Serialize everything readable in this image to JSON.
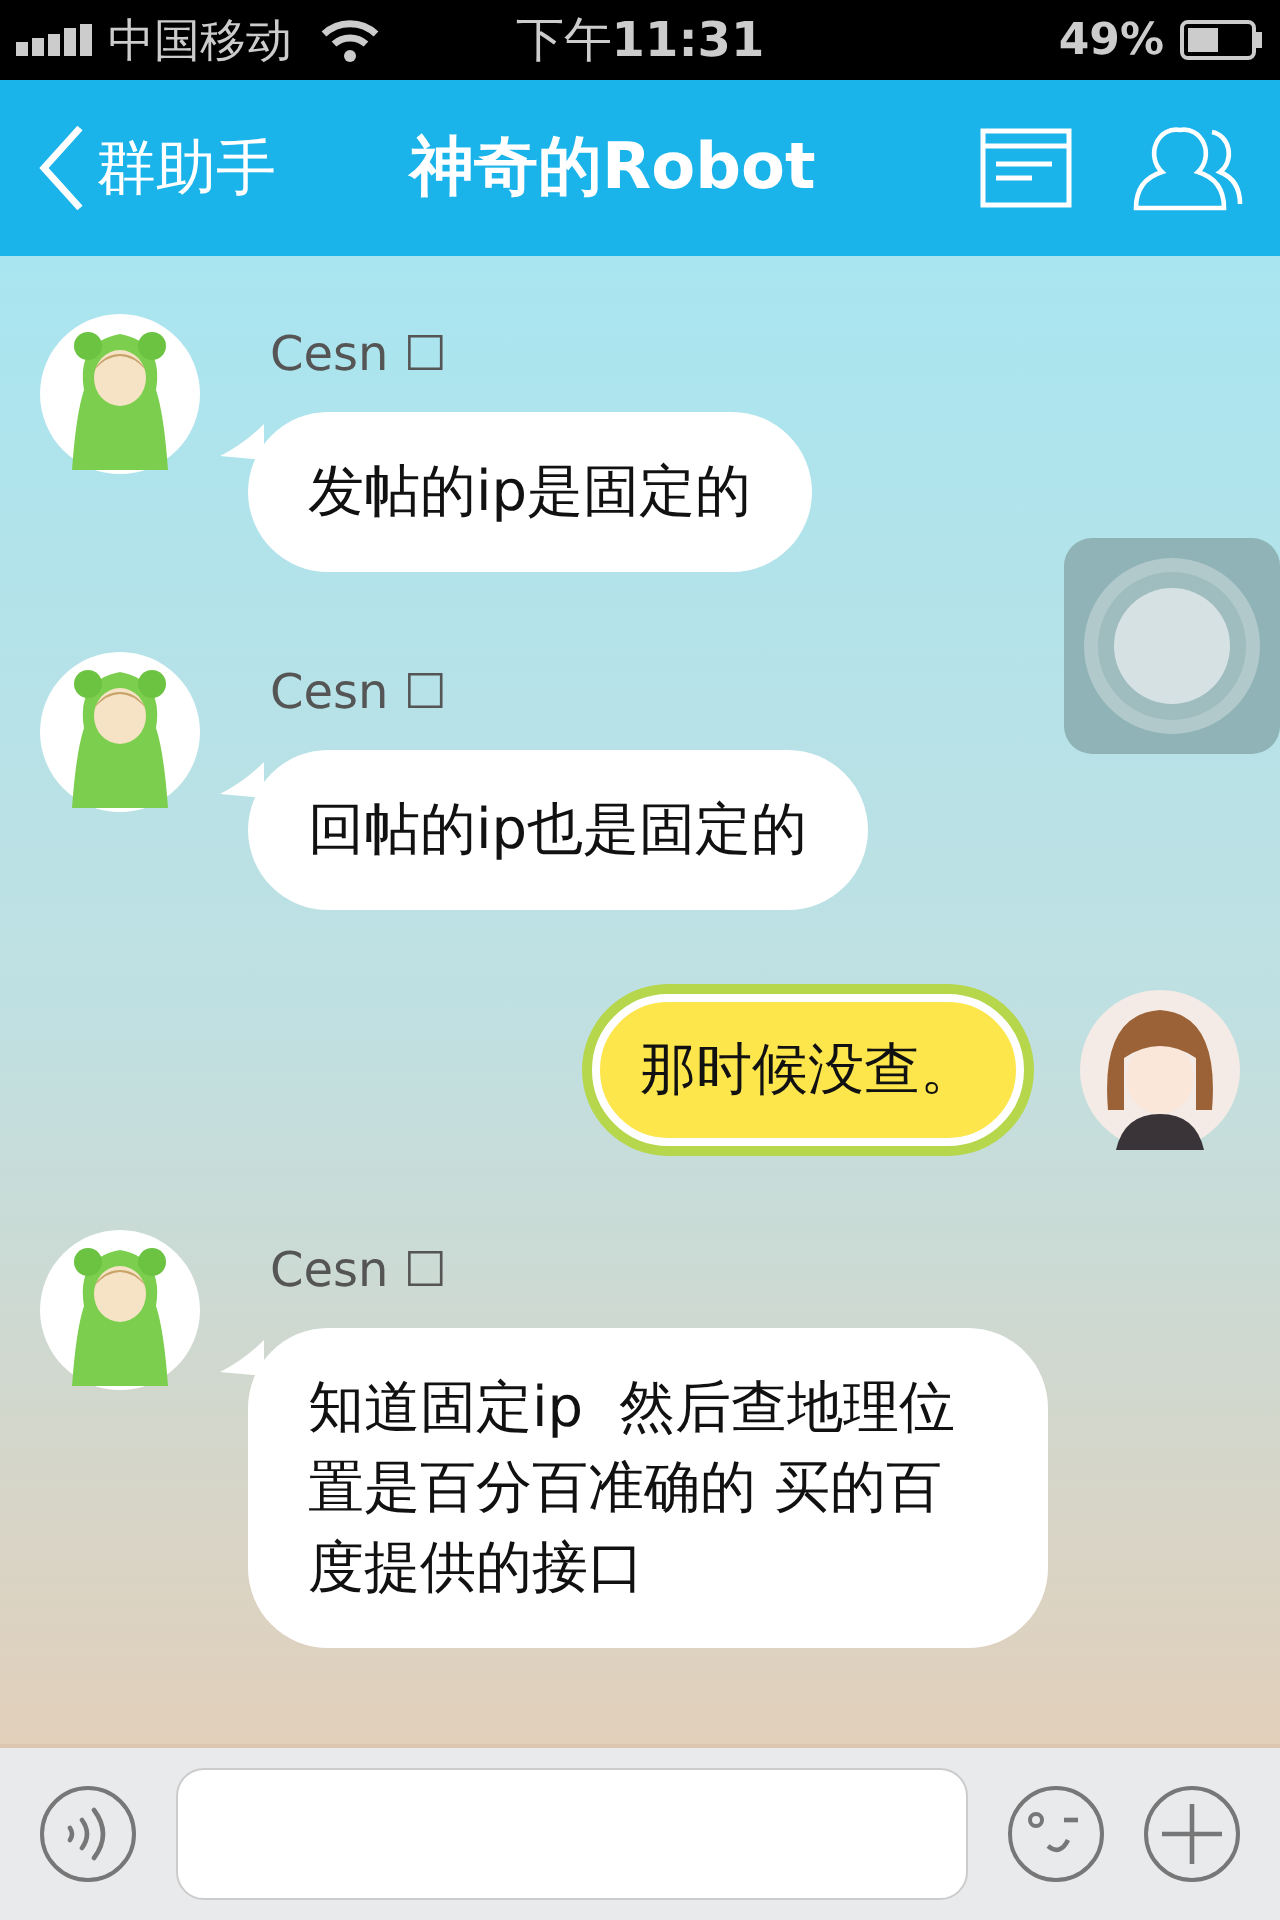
{
  "status_bar": {
    "carrier": "中国移动",
    "time": "下午**11:31**",
    "battery": "49%"
  },
  "nav_bar": {
    "back_label": "群助手",
    "title": "神奇的Robot"
  },
  "messages": [
    {
      "kind": "incoming",
      "sender": "Cesn ☐",
      "text": "发帖的ip是固定的"
    },
    {
      "kind": "incoming",
      "sender": "Cesn ☐",
      "text": "回帖的ip也是固定的"
    },
    {
      "kind": "outgoing",
      "text": "那时候没查。"
    },
    {
      "kind": "incoming",
      "sender": "Cesn ☐",
      "text": "知道固定ip  然后查地理位置是百分百准确的 买的百度提供的接口"
    }
  ]
}
